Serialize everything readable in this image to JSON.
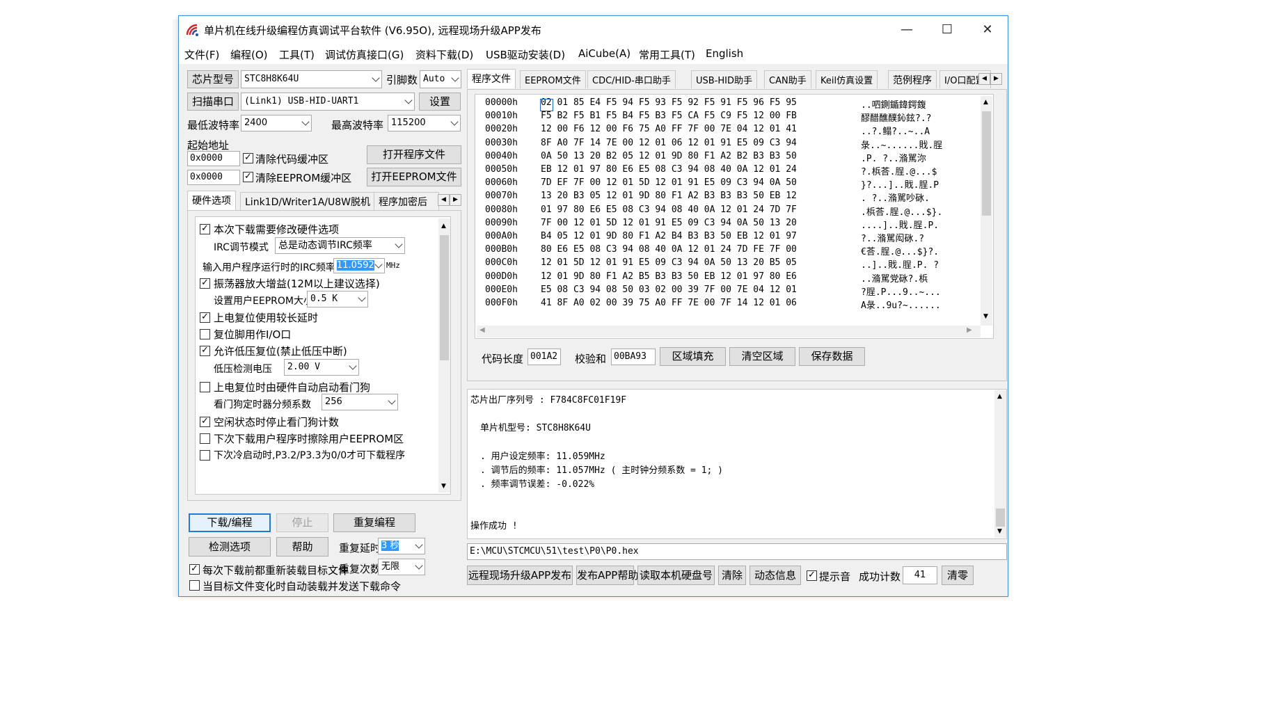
{
  "window": {
    "title": "单片机在线升级编程仿真调试平台软件 (V6.95O), 远程现场升级APP发布",
    "controls": [
      "—",
      "☐",
      "✕"
    ]
  },
  "menu": [
    "文件(F)",
    "编程(O)",
    "工具(T)",
    "调试仿真接口(G)",
    "资料下载(D)",
    "USB驱动安装(D)",
    "AiCube(A)",
    "常用工具(T)",
    "English"
  ],
  "left": {
    "chip_label": "芯片型号",
    "chip_value": "STC8H8K64U",
    "pins_label": "引脚数",
    "pins_value": "Auto",
    "scan_button": "扫描串口",
    "port_value": "(Link1) USB-HID-UART1",
    "settings_button": "设置",
    "min_baud_label": "最低波特率",
    "min_baud_value": "2400",
    "max_baud_label": "最高波特率",
    "max_baud_value": "115200",
    "start_addr_label": "起始地址",
    "addr1": "0x0000",
    "clear_code_label": "清除代码缓冲区",
    "open_program_button": "打开程序文件",
    "addr2": "0x0000",
    "clear_eeprom_label": "清除EEPROM缓冲区",
    "open_eeprom_button": "打开EEPROM文件",
    "tabs": [
      "硬件选项",
      "Link1D/Writer1A/U8W脱机",
      "程序加密后"
    ],
    "hw_options": {
      "opt1": "本次下载需要修改硬件选项",
      "irc_mode_label": "IRC调节模式",
      "irc_mode_value": "总是动态调节IRC频率",
      "irc_freq_label": "输入用户程序运行时的IRC频率",
      "irc_freq_value": "11.0592",
      "irc_freq_unit": "MHz",
      "opt2": "振荡器放大增益(12M以上建议选择)",
      "eeprom_size_label": "设置用户EEPROM大小",
      "eeprom_size_value": "0.5 K",
      "opt3": "上电复位使用较长延时",
      "opt4": "复位脚用作I/O口",
      "opt5": "允许低压复位(禁止低压中断)",
      "lvd_label": "低压检测电压",
      "lvd_value": "2.00 V",
      "opt6": "上电复位时由硬件自动启动看门狗",
      "wdt_label": "看门狗定时器分频系数",
      "wdt_value": "256",
      "opt7": "空闲状态时停止看门狗计数",
      "opt8": "下次下载用户程序时擦除用户EEPROM区",
      "opt9": "下次冷启动时,P3.2/P3.3为0/0才可下载程序"
    },
    "download_button": "下载/编程",
    "stop_button": "停止",
    "reprogram_button": "重复编程",
    "check_button": "检测选项",
    "help_button": "帮助",
    "repeat_delay_label": "重复延时",
    "repeat_delay_value": "3 秒",
    "repeat_count_label": "重复次数",
    "repeat_count_value": "无限",
    "reload_label": "每次下载前都重新装载目标文件",
    "autosend_label": "当目标文件变化时自动装载并发送下载命令"
  },
  "right": {
    "tabs": [
      "程序文件",
      "EEPROM文件",
      "CDC/HID-串口助手",
      "USB-HID助手",
      "CAN助手",
      "Keil仿真设置",
      "范例程序",
      "I/O口配置"
    ],
    "hex_rows": [
      {
        "addr": "00000h",
        "bytes": "02 01 85 E4 F5 94 F5 93 F5 92 F5 91 F5 96 F5 95",
        "ascii": "..呬鍘鍎鍏鍔鍑"
      },
      {
        "addr": "00010h",
        "bytes": "F5 B2 F5 B1 F5 B4 F5 B3 F5 CA F5 C9 F5 12 00 FB",
        "ascii": "醪醋醮醭鈊鉉?.?"
      },
      {
        "addr": "00020h",
        "bytes": "12 00 F6 12 00 F6 75 A0 FF 7F 00 7E 04 12 01 41",
        "ascii": "..?.鳎?..~..A"
      },
      {
        "addr": "00030h",
        "bytes": "8F A0 7F 14 7E 00 12 01 06 12 01 91 E5 09 C3 94",
        "ascii": "彔..~......戝.脭"
      },
      {
        "addr": "00040h",
        "bytes": "0A 50 13 20 B2 05 12 01 9D 80 F1 A2 B2 B3 B3 50",
        "ascii": ".P. ?..潃駡沵"
      },
      {
        "addr": "00050h",
        "bytes": "EB 12 01 97 80 E6 E5 08 C3 94 08 40 0A 12 01 24",
        "ascii": "?.梹荅.脭.@...$"
      },
      {
        "addr": "00060h",
        "bytes": "7D EF 7F 00 12 01 5D 12 01 91 E5 09 C3 94 0A 50",
        "ascii": "}?...]..戝.脭.P"
      },
      {
        "addr": "00070h",
        "bytes": "13 20 B3 05 12 01 9D 80 F1 A2 B3 B3 B3 50 EB 12",
        "ascii": ". ?..潃駡吵砯."
      },
      {
        "addr": "00080h",
        "bytes": "01 97 80 E6 E5 08 C3 94 08 40 0A 12 01 24 7D 7F",
        "ascii": ".梹荅.脭.@...$}."
      },
      {
        "addr": "00090h",
        "bytes": "7F 00 12 01 5D 12 01 91 E5 09 C3 94 0A 50 13 20",
        "ascii": "....]..戝.脭.P."
      },
      {
        "addr": "000A0h",
        "bytes": "B4 05 12 01 9D 80 F1 A2 B4 B3 B3 50 EB 12 01 97",
        "ascii": "?..潃駡闳砯.?"
      },
      {
        "addr": "000B0h",
        "bytes": "80 E6 E5 08 C3 94 08 40 0A 12 01 24 7D FE 7F 00",
        "ascii": "€荅.脭.@...$}?."
      },
      {
        "addr": "000C0h",
        "bytes": "12 01 5D 12 01 91 E5 09 C3 94 0A 50 13 20 B5 05",
        "ascii": "..]..戝.脭.P. ?"
      },
      {
        "addr": "000D0h",
        "bytes": "12 01 9D 80 F1 A2 B5 B3 B3 50 EB 12 01 97 80 E6",
        "ascii": "..潃駡党砯?.梹"
      },
      {
        "addr": "000E0h",
        "bytes": "E5 08 C3 94 08 50 03 02 00 39 7F 00 7E 04 12 01",
        "ascii": "?脭.P...9..~..."
      },
      {
        "addr": "000F0h",
        "bytes": "41 8F A0 02 00 39 75 A0 FF 7E 00 7F 14 12 01 06",
        "ascii": "A彔..9u?~......"
      }
    ],
    "code_len_label": "代码长度",
    "code_len_value": "001A2",
    "checksum_label": "校验和",
    "checksum_value": "00BA93",
    "fill_button": "区域填充",
    "clear_area_button": "清空区域",
    "save_button": "保存数据",
    "log": {
      "line1": "芯片出厂序列号 : F784C8FC01F19F",
      "line2": "单片机型号: STC8H8K64U",
      "line3": ". 用户设定频率: 11.059MHz",
      "line4": ". 调节后的频率: 11.057MHz ( 主时钟分频系数 = 1; )",
      "line5": ". 频率调节误差: -0.022%",
      "line6": "操作成功 !"
    },
    "file_path": "E:\\MCU\\STCMCU\\51\\test\\P0\\P0.hex",
    "remote_app_button": "远程现场升级APP发布",
    "publish_help_button": "发布APP帮助",
    "read_disk_button": "读取本机硬盘号",
    "clear_button": "清除",
    "dynamic_info_button": "动态信息",
    "sound_label": "提示音",
    "success_label": "成功计数",
    "success_value": "41",
    "reset_count_button": "清零"
  },
  "colors": {
    "window_border": "#3c8fd6",
    "focus_blue": "#1e7ad6",
    "selection": "#3399ff",
    "chrome": "#f0f0f0"
  }
}
